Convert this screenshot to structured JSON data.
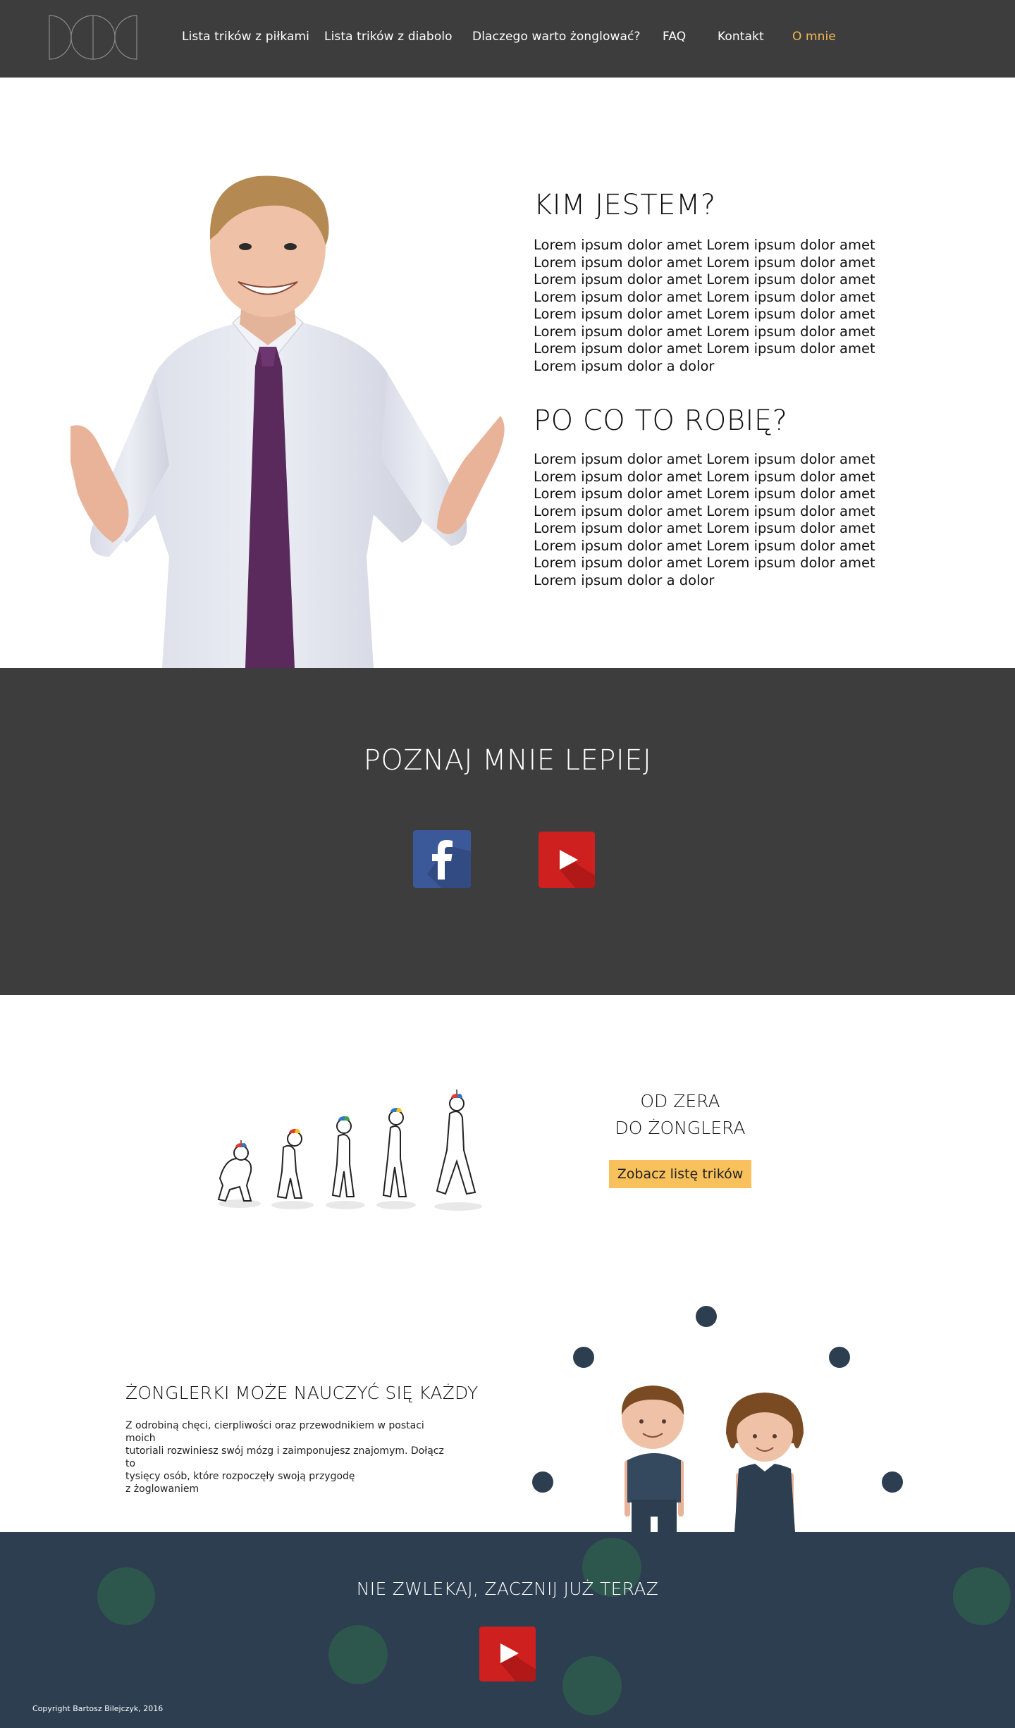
{
  "nav": {
    "items": [
      {
        "label": "Lista trików z piłkami",
        "active": false
      },
      {
        "label": "Lista trików z diabolo",
        "active": false
      },
      {
        "label": "Dlaczego warto żonglować?",
        "active": false
      },
      {
        "label": "FAQ",
        "active": false
      },
      {
        "label": "Kontakt",
        "active": false
      },
      {
        "label": "O mnie",
        "active": true
      }
    ]
  },
  "about": {
    "who_title": "KIM JESTEM?",
    "who_text": "Lorem ipsum dolor amet Lorem ipsum dolor amet Lorem ipsum dolor amet Lorem ipsum dolor amet Lorem ipsum dolor amet Lorem ipsum dolor amet Lorem ipsum dolor amet Lorem ipsum dolor amet Lorem ipsum dolor amet Lorem ipsum dolor amet Lorem ipsum dolor amet Lorem ipsum dolor amet Lorem ipsum dolor amet Lorem ipsum dolor amet Lorem ipsum dolor a dolor",
    "why_title": "PO CO TO ROBIĘ?",
    "why_text": "Lorem ipsum dolor amet Lorem ipsum dolor amet Lorem ipsum dolor amet Lorem ipsum dolor amet Lorem ipsum dolor amet Lorem ipsum dolor amet Lorem ipsum dolor amet Lorem ipsum dolor amet Lorem ipsum dolor amet Lorem ipsum dolor amet Lorem ipsum dolor amet Lorem ipsum dolor amet Lorem ipsum dolor amet Lorem ipsum dolor amet Lorem ipsum dolor a dolor"
  },
  "poznaj": {
    "title": "POZNAJ MNIE LEPIEJ",
    "icons": [
      "facebook-icon",
      "youtube-icon"
    ]
  },
  "od_zera": {
    "title_line1": "OD ZERA",
    "title_line2": "DO ŻONGLERA",
    "button": "Zobacz listę trików"
  },
  "everyone": {
    "title": "ŻONGLERKI MOŻE NAUCZYĆ SIĘ KAŻDY",
    "text_line1": "Z odrobiną chęci, cierpliwości oraz przewodnikiem w postaci moich",
    "text_line2": "tutoriali rozwiniesz swój mózg i zaimponujesz znajomym. Dołącz to",
    "text_line3": "tysięcy osób, które rozpoczęły swoją przygodę",
    "text_line4": "z żoglowaniem"
  },
  "footer": {
    "title": "NIE ZWLEKAJ, ZACZNIJ JUŻ TERAZ",
    "copyright": "Copyright Bartosz Bilejczyk, 2016"
  },
  "colors": {
    "nav_bg": "#3d3d3d",
    "accent": "#f6b955",
    "button": "#f8c15b",
    "footer_bg": "#2c3e50",
    "facebook": "#3b5998",
    "youtube": "#cd201f"
  }
}
